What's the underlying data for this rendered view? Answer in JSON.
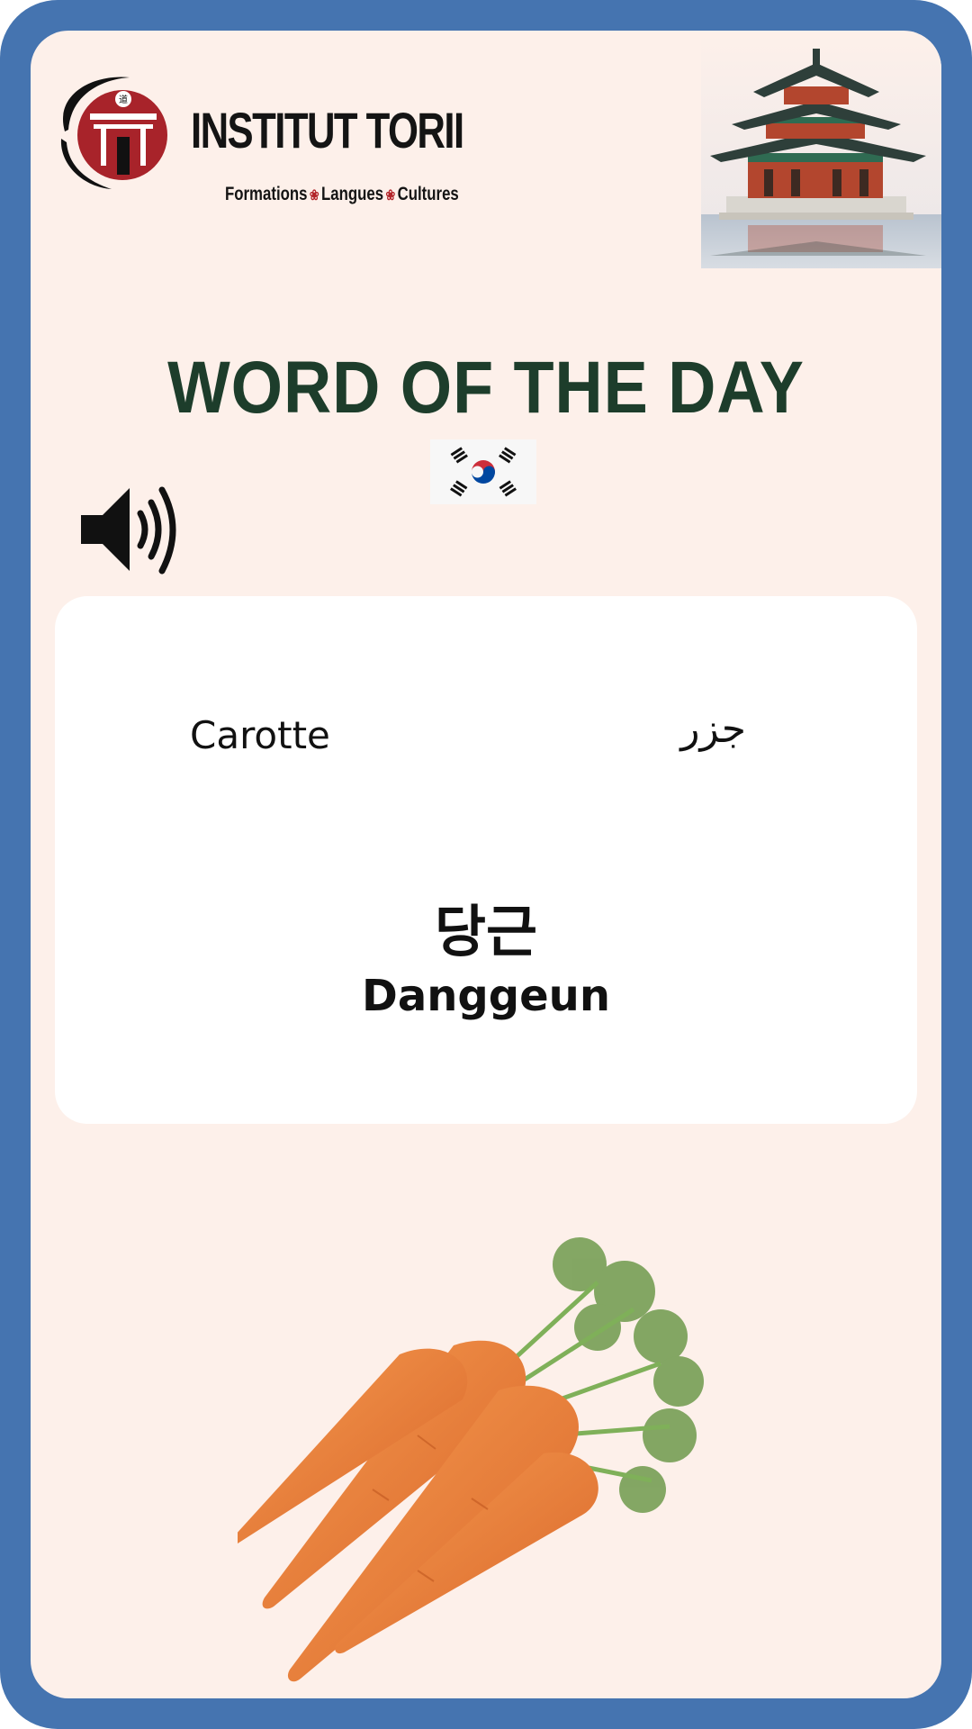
{
  "brand": {
    "name": "INSTITUT TORII",
    "tagline_parts": [
      "Formations",
      "Langues",
      "Cultures"
    ],
    "logo_glyphs": [
      "道",
      "鳥居"
    ]
  },
  "title": "WORD OF THE DAY",
  "language_flag": "south-korea-flag",
  "audio": {
    "icon": "speaker-icon"
  },
  "word": {
    "french": "Carotte",
    "arabic": "جزر",
    "korean": "당근",
    "romanization": "Danggeun"
  },
  "colors": {
    "frame": "#4574b0",
    "background": "#fdf0ea",
    "title": "#1d3d2b",
    "brand_red": "#b3252a"
  }
}
